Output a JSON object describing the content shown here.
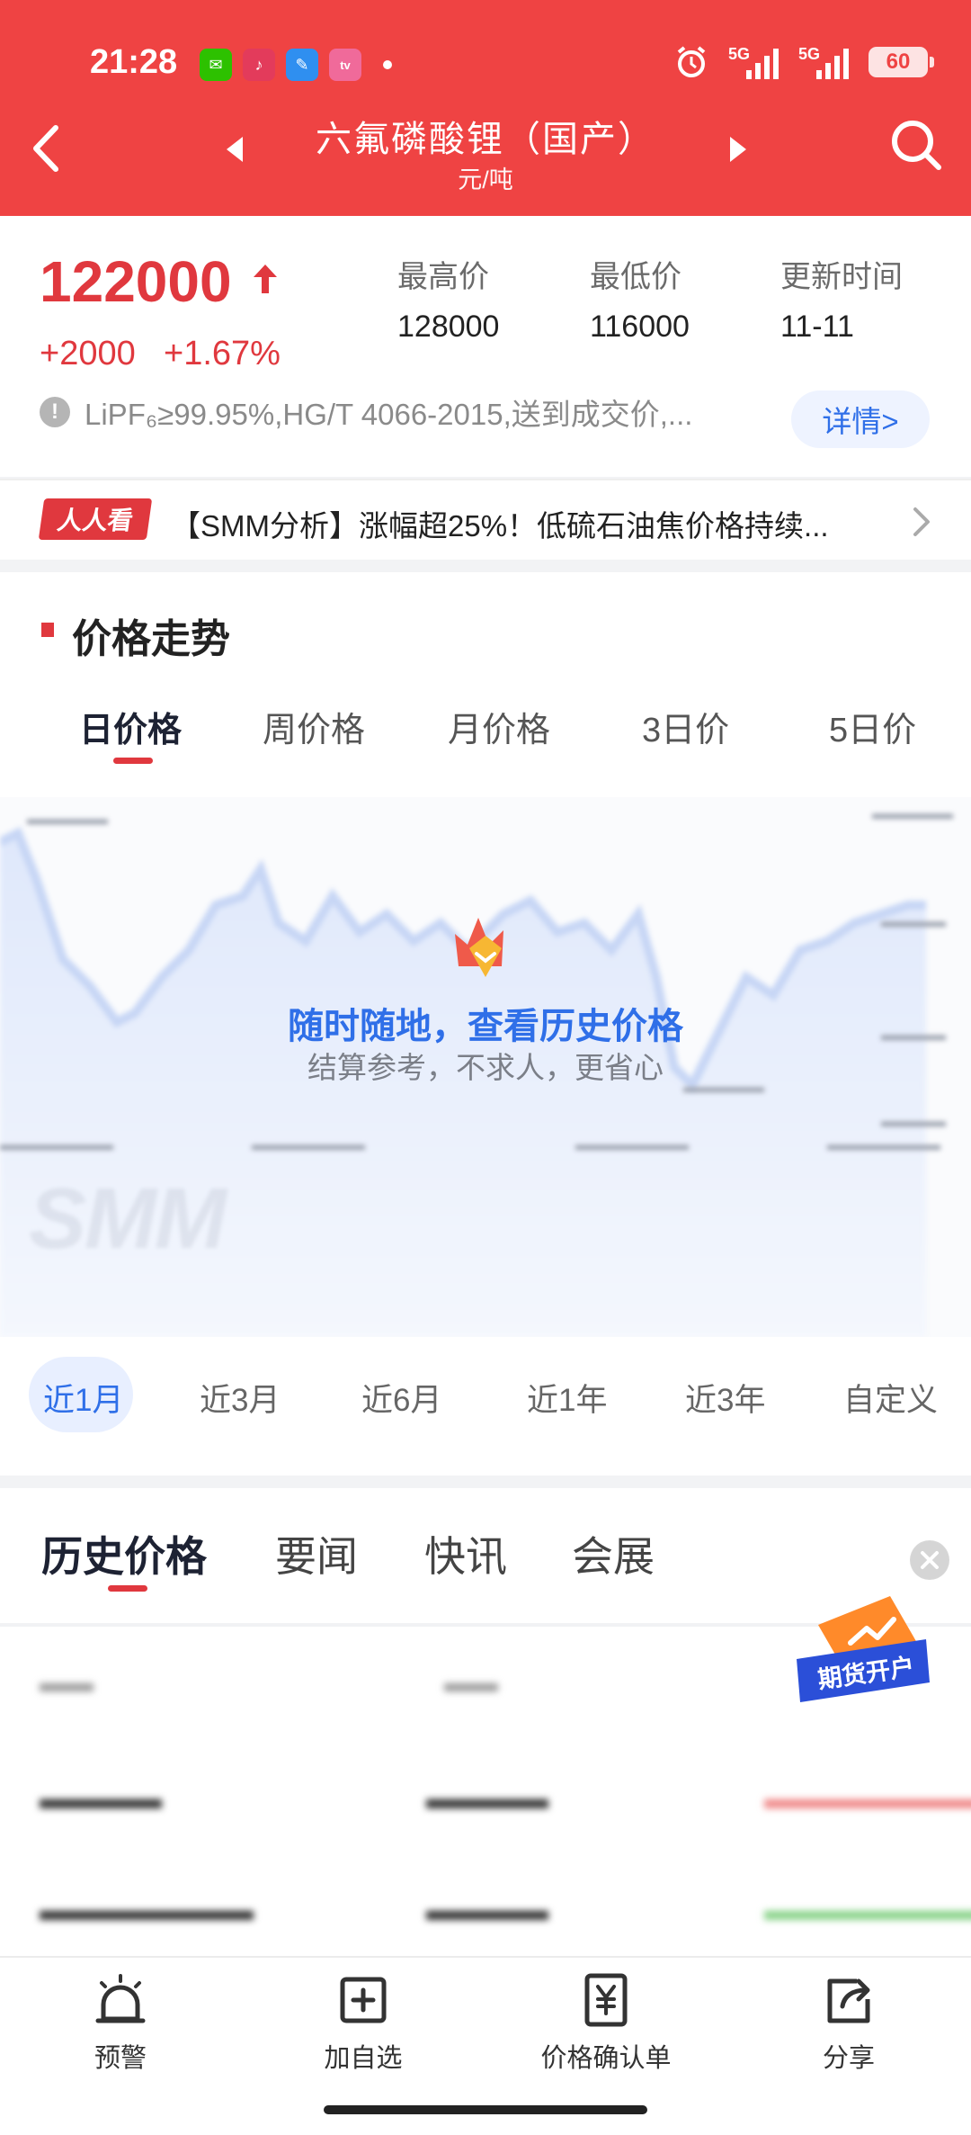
{
  "status_bar": {
    "time": "21:28",
    "battery": "60",
    "net1": "5G",
    "net2": "5G"
  },
  "header": {
    "title": "六氟磷酸锂（国产）",
    "unit": "元/吨"
  },
  "price": {
    "current": "122000",
    "change": "+2000",
    "change_pct": "+1.67%",
    "stats": [
      {
        "label": "最高价",
        "value": "128000"
      },
      {
        "label": "最低价",
        "value": "116000"
      },
      {
        "label": "更新时间",
        "value": "11-11"
      }
    ],
    "spec": "LiPF₆≥99.95%,HG/T 4066-2015,送到成交价,...",
    "detail_label": "详情>"
  },
  "ticker": {
    "badge": "人人看",
    "text": "【SMM分析】涨幅超25%！低硫石油焦价格持续..."
  },
  "trend": {
    "title": "价格走势",
    "period_tabs": [
      "日价格",
      "周价格",
      "月价格",
      "3日价",
      "5日价"
    ],
    "promo_title": "随时随地，查看历史价格",
    "promo_subtitle": "结算参考，不求人，更省心",
    "watermark": "SMM",
    "range_tabs": [
      "近1月",
      "近3月",
      "近6月",
      "近1年",
      "近3年",
      "自定义"
    ]
  },
  "history": {
    "tabs": [
      "历史价格",
      "要闻",
      "快讯",
      "会展"
    ],
    "futures_badge": "期货开户"
  },
  "bottom_bar": {
    "items": [
      {
        "label": "预警",
        "icon": "alarm-bell-icon"
      },
      {
        "label": "加自选",
        "icon": "add-square-icon"
      },
      {
        "label": "价格确认单",
        "icon": "yuan-document-icon"
      },
      {
        "label": "分享",
        "icon": "share-icon"
      }
    ]
  },
  "colors": {
    "header_red": "#ef4343",
    "price_red": "#e0383e",
    "accent_blue": "#2f6fe8"
  }
}
